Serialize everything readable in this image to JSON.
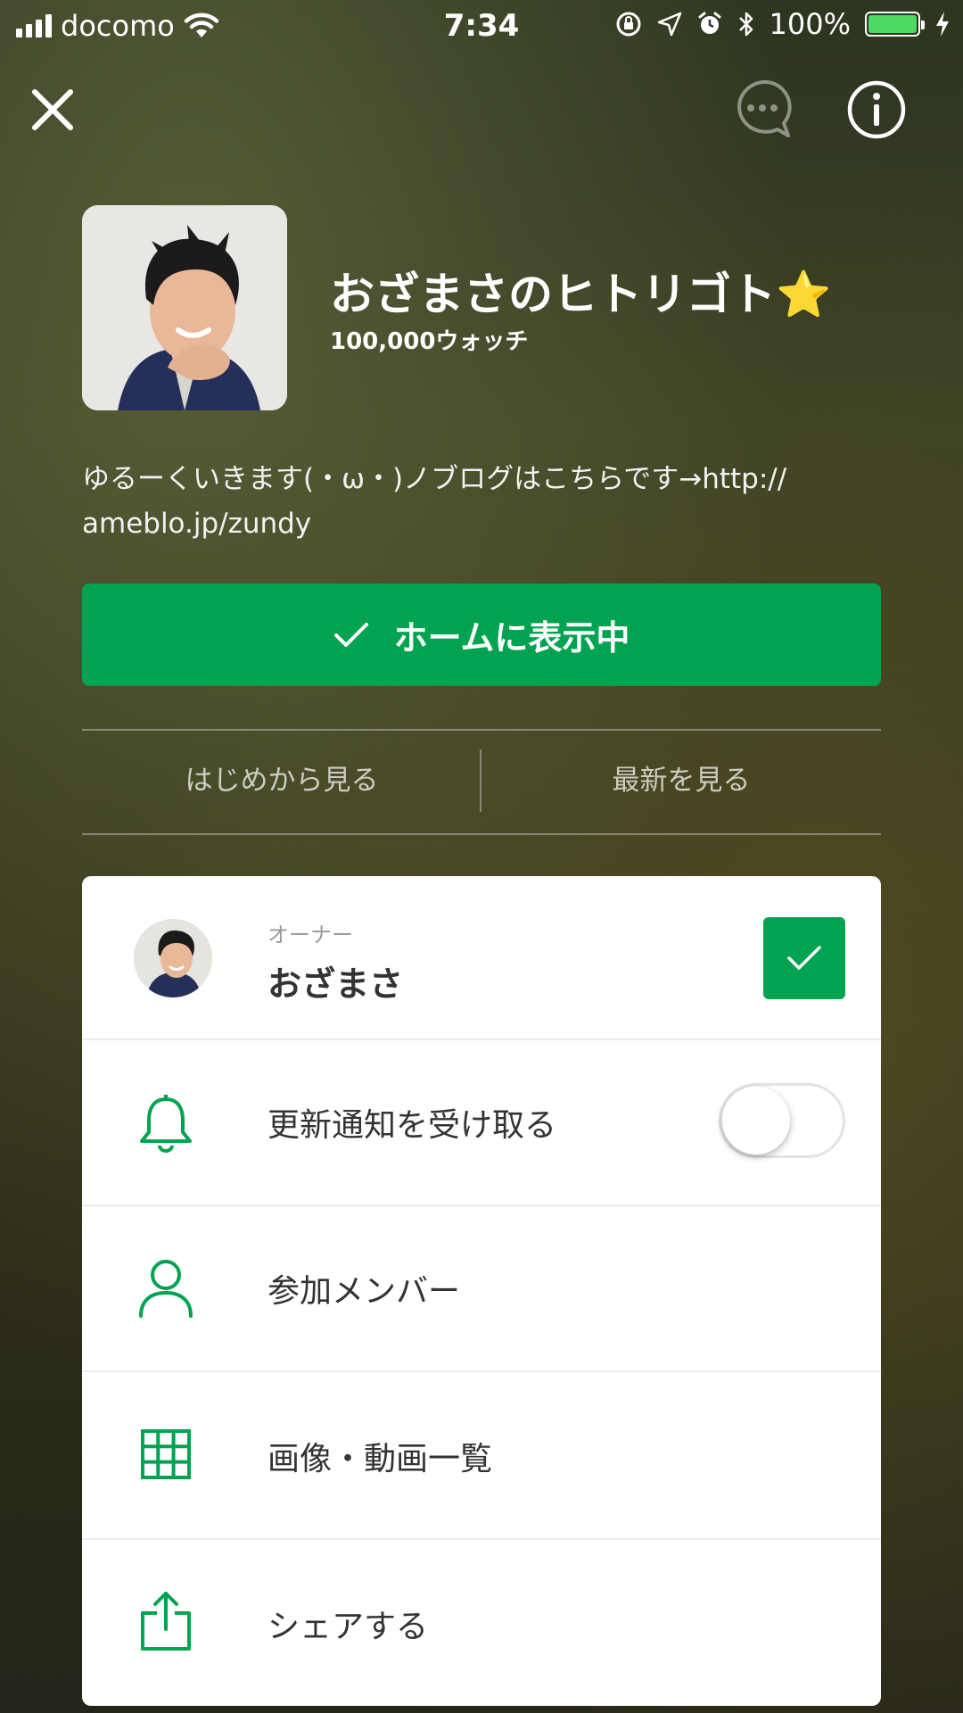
{
  "status_bar": {
    "carrier": "docomo",
    "time": "7:34",
    "battery": "100%",
    "battery_color": "#4cd964"
  },
  "header": {
    "close_icon": "close-icon",
    "chat_icon": "chat-bubble-icon",
    "info_icon": "info-icon"
  },
  "profile": {
    "title": "おざまさのヒトリゴト⭐️",
    "watchers": "100,000ウォッチ",
    "description": "ゆるーくいきます(・ω・)ノブログはこちらです→http:// ameblo.jp/zundy"
  },
  "home_button": {
    "label": "ホームに表示中",
    "color": "#01a350"
  },
  "nav": {
    "from_start": "はじめから見る",
    "latest": "最新を見る"
  },
  "card": {
    "owner": {
      "sub_label": "オーナー",
      "name": "おざまさ"
    },
    "notify": {
      "label": "更新通知を受け取る",
      "enabled": false
    },
    "members": {
      "label": "参加メンバー",
      "icon": "person-icon"
    },
    "media": {
      "label": "画像・動画一覧",
      "icon": "grid-icon"
    },
    "share": {
      "label": "シェアする",
      "icon": "share-icon"
    }
  },
  "accent_color": "#01a350"
}
